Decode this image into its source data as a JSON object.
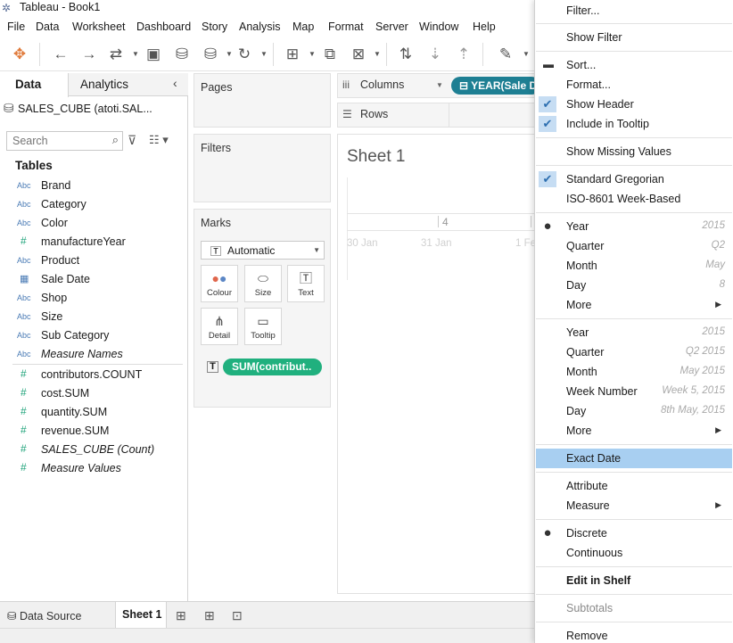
{
  "window": {
    "title": "Tableau - Book1"
  },
  "menubar": [
    "File",
    "Data",
    "Worksheet",
    "Dashboard",
    "Story",
    "Analysis",
    "Map",
    "Format",
    "Server",
    "Window",
    "Help"
  ],
  "datapane": {
    "tab_data": "Data",
    "tab_analytics": "Analytics",
    "datasource": "SALES_CUBE (atoti.SAL...",
    "search_placeholder": "Search",
    "tables_title": "Tables",
    "fields": [
      {
        "type": "Abc",
        "name": "Brand"
      },
      {
        "type": "Abc",
        "name": "Category"
      },
      {
        "type": "Abc",
        "name": "Color"
      },
      {
        "type": "#",
        "name": "manufactureYear"
      },
      {
        "type": "Abc",
        "name": "Product"
      },
      {
        "type": "date",
        "name": "Sale Date"
      },
      {
        "type": "Abc",
        "name": "Shop"
      },
      {
        "type": "Abc",
        "name": "Size"
      },
      {
        "type": "Abc",
        "name": "Sub Category"
      },
      {
        "type": "Abc",
        "name": "Measure Names"
      },
      {
        "type": "#",
        "name": "contributors.COUNT"
      },
      {
        "type": "#",
        "name": "cost.SUM"
      },
      {
        "type": "#",
        "name": "quantity.SUM"
      },
      {
        "type": "#",
        "name": "revenue.SUM"
      },
      {
        "type": "#",
        "name": "SALES_CUBE (Count)"
      },
      {
        "type": "#",
        "name": "Measure Values"
      }
    ]
  },
  "shelves": {
    "pages": "Pages",
    "filters": "Filters",
    "marks": "Marks",
    "mark_type": "Automatic",
    "mark_buttons": {
      "colour": "Colour",
      "size": "Size",
      "text": "Text",
      "detail": "Detail",
      "tooltip": "Tooltip"
    },
    "marks_pill": "SUM(contribut..",
    "columns": "Columns",
    "rows": "Rows",
    "columns_pill": "YEAR(Sale D"
  },
  "sheet": {
    "title": "Sheet 1",
    "year_header": "4",
    "day_labels": [
      "30 Jan",
      "31 Jan",
      "1 Fe"
    ]
  },
  "bottom": {
    "datasource_tab": "Data Source",
    "sheet_tab": "Sheet 1"
  },
  "context_menu": {
    "filter": "Filter...",
    "show_filter": "Show Filter",
    "sort": "Sort...",
    "format": "Format...",
    "show_header": "Show Header",
    "include_tooltip": "Include in Tooltip",
    "show_missing": "Show Missing Values",
    "std_gregorian": "Standard Gregorian",
    "iso_week": "ISO-8601 Week-Based",
    "group1": [
      {
        "label": "Year",
        "example": "2015"
      },
      {
        "label": "Quarter",
        "example": "Q2"
      },
      {
        "label": "Month",
        "example": "May"
      },
      {
        "label": "Day",
        "example": "8"
      },
      {
        "label": "More",
        "example": ""
      }
    ],
    "group2": [
      {
        "label": "Year",
        "example": "2015"
      },
      {
        "label": "Quarter",
        "example": "Q2 2015"
      },
      {
        "label": "Month",
        "example": "May 2015"
      },
      {
        "label": "Week Number",
        "example": "Week 5, 2015"
      },
      {
        "label": "Day",
        "example": "8th May, 2015"
      },
      {
        "label": "More",
        "example": ""
      }
    ],
    "exact_date": "Exact Date",
    "attribute": "Attribute",
    "measure": "Measure",
    "discrete": "Discrete",
    "continuous": "Continuous",
    "edit_in_shelf": "Edit in Shelf",
    "subtotals": "Subtotals",
    "remove": "Remove"
  }
}
